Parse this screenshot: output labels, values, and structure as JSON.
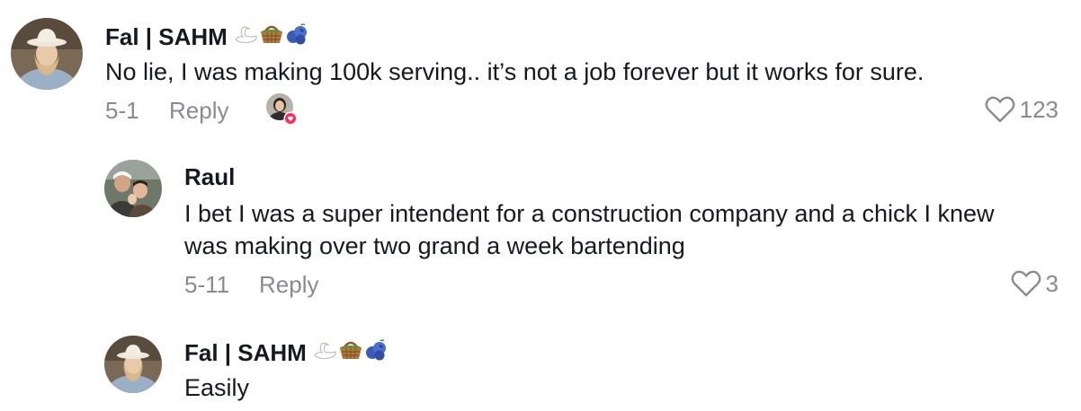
{
  "comments": [
    {
      "username": "Fal | SAHM",
      "emoji_icons": [
        "swan-icon",
        "basket-icon",
        "blueberries-icon"
      ],
      "text": "No lie, I was making 100k serving.. it’s not a job forever but it works for sure.",
      "date": "5-1",
      "reply_label": "Reply",
      "like_count": "123",
      "creator_liked": true
    },
    {
      "username": "Raul",
      "text": "I bet I was a super intendent for a construction company and a chick I knew was making over two grand a week bartending",
      "date": "5-11",
      "reply_label": "Reply",
      "like_count": "3"
    },
    {
      "username": "Fal | SAHM",
      "emoji_icons": [
        "swan-icon",
        "basket-icon",
        "blueberries-icon"
      ],
      "text": "Easily"
    }
  ],
  "colors": {
    "primary_text": "#161823",
    "secondary_text": "#8a8b91",
    "like_badge": "#fe2c55"
  }
}
